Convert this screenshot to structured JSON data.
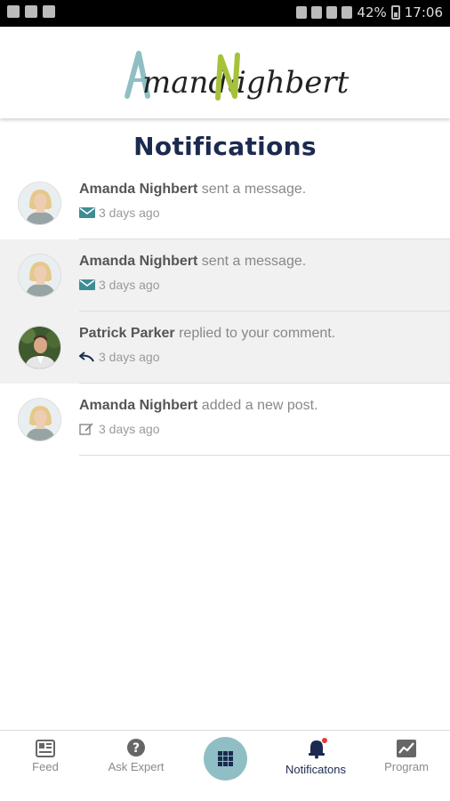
{
  "status_bar": {
    "battery": "42%",
    "time": "17:06"
  },
  "header": {
    "logo_first": "Amanda",
    "logo_last": "Nighbert",
    "logo_colors": {
      "accent_a": "#8fbfc4",
      "accent_n": "#a6c23a",
      "ink": "#222222"
    }
  },
  "page": {
    "title": "Notifications"
  },
  "notifications": [
    {
      "name": "Amanda Nighbert",
      "action": "sent a message.",
      "time": "3 days ago",
      "icon": "mail-icon",
      "avatar": "amanda-avatar",
      "shaded": false
    },
    {
      "name": "Amanda Nighbert",
      "action": "sent a message.",
      "time": "3 days ago",
      "icon": "mail-icon",
      "avatar": "amanda-avatar",
      "shaded": true
    },
    {
      "name": "Patrick Parker",
      "action": "replied to your comment.",
      "time": "3 days ago",
      "icon": "reply-icon",
      "avatar": "patrick-avatar",
      "shaded": true
    },
    {
      "name": "Amanda Nighbert",
      "action": "added a new post.",
      "time": "3 days ago",
      "icon": "edit-icon",
      "avatar": "amanda-avatar",
      "shaded": false
    }
  ],
  "bottom_nav": {
    "feed": "Feed",
    "ask_expert": "Ask Expert",
    "notifications": "Notificatons",
    "program": "Program"
  },
  "colors": {
    "navy": "#1b2a4e",
    "teal": "#3f8c95",
    "center_button": "#8fbfc4",
    "badge_red": "#e53935"
  }
}
